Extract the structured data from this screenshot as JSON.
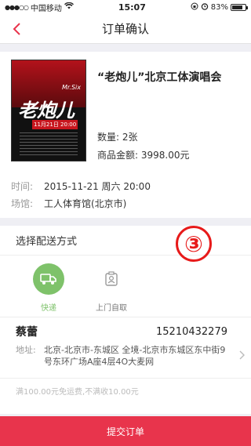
{
  "status_bar": {
    "carrier": "中国移动",
    "time": "15:07",
    "battery": "83%",
    "battery_level": 0.83
  },
  "header": {
    "title": "订单确认"
  },
  "event": {
    "poster": {
      "brand": "Mr.Six",
      "title": "老炮儿",
      "date": "11月21日 20:00"
    },
    "name": "“老炮儿”北京工体演唱会",
    "quantity_label": "数量: 2张",
    "amount_label": "商品金额: 3998.00元",
    "time_label": "时间:",
    "time_value": "2015-11-21 周六 20:00",
    "venue_label": "场馆:",
    "venue_value": "工人体育馆(北京市)"
  },
  "delivery": {
    "section_title": "选择配送方式",
    "step_badge": "③",
    "options": [
      {
        "label": "快递",
        "icon": "delivery-truck-icon",
        "selected": true
      },
      {
        "label": "上门自取",
        "icon": "pickup-store-icon",
        "selected": false
      }
    ],
    "address": {
      "name": "蔡蕾",
      "phone": "15210432279",
      "label": "地址:",
      "text": "北京-北京市-东城区 全境-北京市东城区东中街9号东环广场A座4层4O大麦网"
    },
    "note": "满100.00元免运费,不满收10.00元"
  },
  "footer": {
    "submit_label": "提交订单"
  },
  "colors": {
    "accent": "#e8344c",
    "back_arrow": "#e8344c",
    "selected_option": "#7ec26a",
    "badge": "#e71a1a"
  }
}
